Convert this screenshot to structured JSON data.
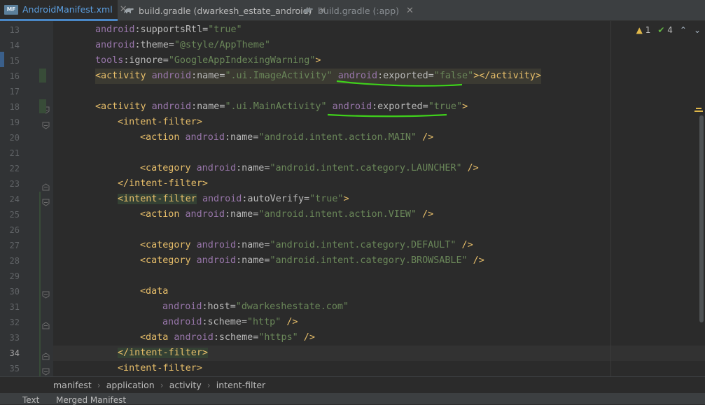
{
  "tabs": [
    {
      "label": "AndroidManifest.xml",
      "icon": "manifest-icon",
      "active": true
    },
    {
      "label": "build.gradle (dwarkesh_estate_android)",
      "icon": "gradle-icon",
      "active": false
    },
    {
      "label": "build.gradle (:app)",
      "icon": "gradle-icon",
      "active": false
    }
  ],
  "inspections": {
    "warnings": "1",
    "passed": "4"
  },
  "code_lines": [
    {
      "num": "13",
      "tokens": [
        {
          "t": "android",
          "c": "t-ns"
        },
        {
          "t": ":supportsRtl=",
          "c": "t-attr"
        },
        {
          "t": "\"true\"",
          "c": "t-val"
        }
      ],
      "indent": 136
    },
    {
      "num": "14",
      "tokens": [
        {
          "t": "android",
          "c": "t-ns"
        },
        {
          "t": ":theme=",
          "c": "t-attr"
        },
        {
          "t": "\"@style/AppTheme\"",
          "c": "t-val"
        }
      ],
      "indent": 136
    },
    {
      "num": "15",
      "tokens": [
        {
          "t": "tools",
          "c": "t-ns"
        },
        {
          "t": ":ignore=",
          "c": "t-attr"
        },
        {
          "t": "\"GoogleAppIndexingWarning\"",
          "c": "t-val"
        },
        {
          "t": ">",
          "c": "t-tag"
        }
      ],
      "indent": 136
    },
    {
      "num": "16",
      "hl": true,
      "tokens": [
        {
          "t": "<activity ",
          "c": "t-tag"
        },
        {
          "t": "android",
          "c": "t-ns"
        },
        {
          "t": ":name=",
          "c": "t-attr"
        },
        {
          "t": "\".ui.ImageActivity\"",
          "c": "t-val"
        },
        {
          "t": " ",
          "c": "t-plain"
        },
        {
          "t": "android",
          "c": "t-ns"
        },
        {
          "t": ":exported=",
          "c": "t-attr"
        },
        {
          "t": "\"false\"",
          "c": "t-val"
        },
        {
          "t": "></activity>",
          "c": "t-tag"
        }
      ],
      "indent": 136
    },
    {
      "num": "17",
      "tokens": [],
      "indent": 136
    },
    {
      "num": "18",
      "tokens": [
        {
          "t": "<activity ",
          "c": "t-tag"
        },
        {
          "t": "android",
          "c": "t-ns"
        },
        {
          "t": ":name=",
          "c": "t-attr"
        },
        {
          "t": "\".ui.MainActivity\"",
          "c": "t-val"
        },
        {
          "t": " ",
          "c": "t-plain"
        },
        {
          "t": "android",
          "c": "t-ns"
        },
        {
          "t": ":exported=",
          "c": "t-attr"
        },
        {
          "t": "\"true\"",
          "c": "t-val"
        },
        {
          "t": ">",
          "c": "t-tag"
        }
      ],
      "indent": 136
    },
    {
      "num": "19",
      "tokens": [
        {
          "t": "<intent-filter>",
          "c": "t-tag"
        }
      ],
      "indent": 168
    },
    {
      "num": "20",
      "tokens": [
        {
          "t": "<action ",
          "c": "t-tag"
        },
        {
          "t": "android",
          "c": "t-ns"
        },
        {
          "t": ":name=",
          "c": "t-attr"
        },
        {
          "t": "\"android.intent.action.MAIN\"",
          "c": "t-val"
        },
        {
          "t": " />",
          "c": "t-tag"
        }
      ],
      "indent": 200
    },
    {
      "num": "21",
      "tokens": [],
      "indent": 200
    },
    {
      "num": "22",
      "tokens": [
        {
          "t": "<category ",
          "c": "t-tag"
        },
        {
          "t": "android",
          "c": "t-ns"
        },
        {
          "t": ":name=",
          "c": "t-attr"
        },
        {
          "t": "\"android.intent.category.LAUNCHER\"",
          "c": "t-val"
        },
        {
          "t": " />",
          "c": "t-tag"
        }
      ],
      "indent": 200
    },
    {
      "num": "23",
      "tokens": [
        {
          "t": "</intent-filter>",
          "c": "t-tag"
        }
      ],
      "indent": 168
    },
    {
      "num": "24",
      "tokens": [
        {
          "t": "<intent-filter",
          "c": "t-tag t-hilite"
        },
        {
          "t": " ",
          "c": "t-plain"
        },
        {
          "t": "android",
          "c": "t-ns"
        },
        {
          "t": ":autoVerify=",
          "c": "t-attr"
        },
        {
          "t": "\"true\"",
          "c": "t-val"
        },
        {
          "t": ">",
          "c": "t-tag"
        }
      ],
      "indent": 168
    },
    {
      "num": "25",
      "tokens": [
        {
          "t": "<action ",
          "c": "t-tag"
        },
        {
          "t": "android",
          "c": "t-ns"
        },
        {
          "t": ":name=",
          "c": "t-attr"
        },
        {
          "t": "\"android.intent.action.VIEW\"",
          "c": "t-val"
        },
        {
          "t": " />",
          "c": "t-tag"
        }
      ],
      "indent": 200
    },
    {
      "num": "26",
      "tokens": [],
      "indent": 200
    },
    {
      "num": "27",
      "tokens": [
        {
          "t": "<category ",
          "c": "t-tag"
        },
        {
          "t": "android",
          "c": "t-ns"
        },
        {
          "t": ":name=",
          "c": "t-attr"
        },
        {
          "t": "\"android.intent.category.DEFAULT\"",
          "c": "t-val"
        },
        {
          "t": " />",
          "c": "t-tag"
        }
      ],
      "indent": 200
    },
    {
      "num": "28",
      "tokens": [
        {
          "t": "<category ",
          "c": "t-tag"
        },
        {
          "t": "android",
          "c": "t-ns"
        },
        {
          "t": ":name=",
          "c": "t-attr"
        },
        {
          "t": "\"android.intent.category.BROWSABLE\"",
          "c": "t-val"
        },
        {
          "t": " />",
          "c": "t-tag"
        }
      ],
      "indent": 200
    },
    {
      "num": "29",
      "tokens": [],
      "indent": 200
    },
    {
      "num": "30",
      "tokens": [
        {
          "t": "<data",
          "c": "t-tag"
        }
      ],
      "indent": 200
    },
    {
      "num": "31",
      "tokens": [
        {
          "t": "android",
          "c": "t-ns"
        },
        {
          "t": ":host=",
          "c": "t-attr"
        },
        {
          "t": "\"dwarkeshestate.com\"",
          "c": "t-val"
        }
      ],
      "indent": 232
    },
    {
      "num": "32",
      "tokens": [
        {
          "t": "android",
          "c": "t-ns"
        },
        {
          "t": ":scheme=",
          "c": "t-attr"
        },
        {
          "t": "\"http\"",
          "c": "t-val"
        },
        {
          "t": " />",
          "c": "t-tag"
        }
      ],
      "indent": 232
    },
    {
      "num": "33",
      "tokens": [
        {
          "t": "<data ",
          "c": "t-tag"
        },
        {
          "t": "android",
          "c": "t-ns"
        },
        {
          "t": ":scheme=",
          "c": "t-attr"
        },
        {
          "t": "\"https\"",
          "c": "t-val"
        },
        {
          "t": " />",
          "c": "t-tag"
        }
      ],
      "indent": 200
    },
    {
      "num": "34",
      "current": true,
      "tokens": [
        {
          "t": "</intent-filter>",
          "c": "t-tag t-hilite"
        }
      ],
      "indent": 168
    },
    {
      "num": "35",
      "tokens": [
        {
          "t": "<intent-filter>",
          "c": "t-tag"
        }
      ],
      "indent": 168
    }
  ],
  "breadcrumb": [
    "manifest",
    "application",
    "activity",
    "intent-filter"
  ],
  "bottom_tabs": [
    "Text",
    "Merged Manifest"
  ],
  "colors": {
    "accent": "#4a88c7",
    "annotation": "#3fd11b"
  }
}
